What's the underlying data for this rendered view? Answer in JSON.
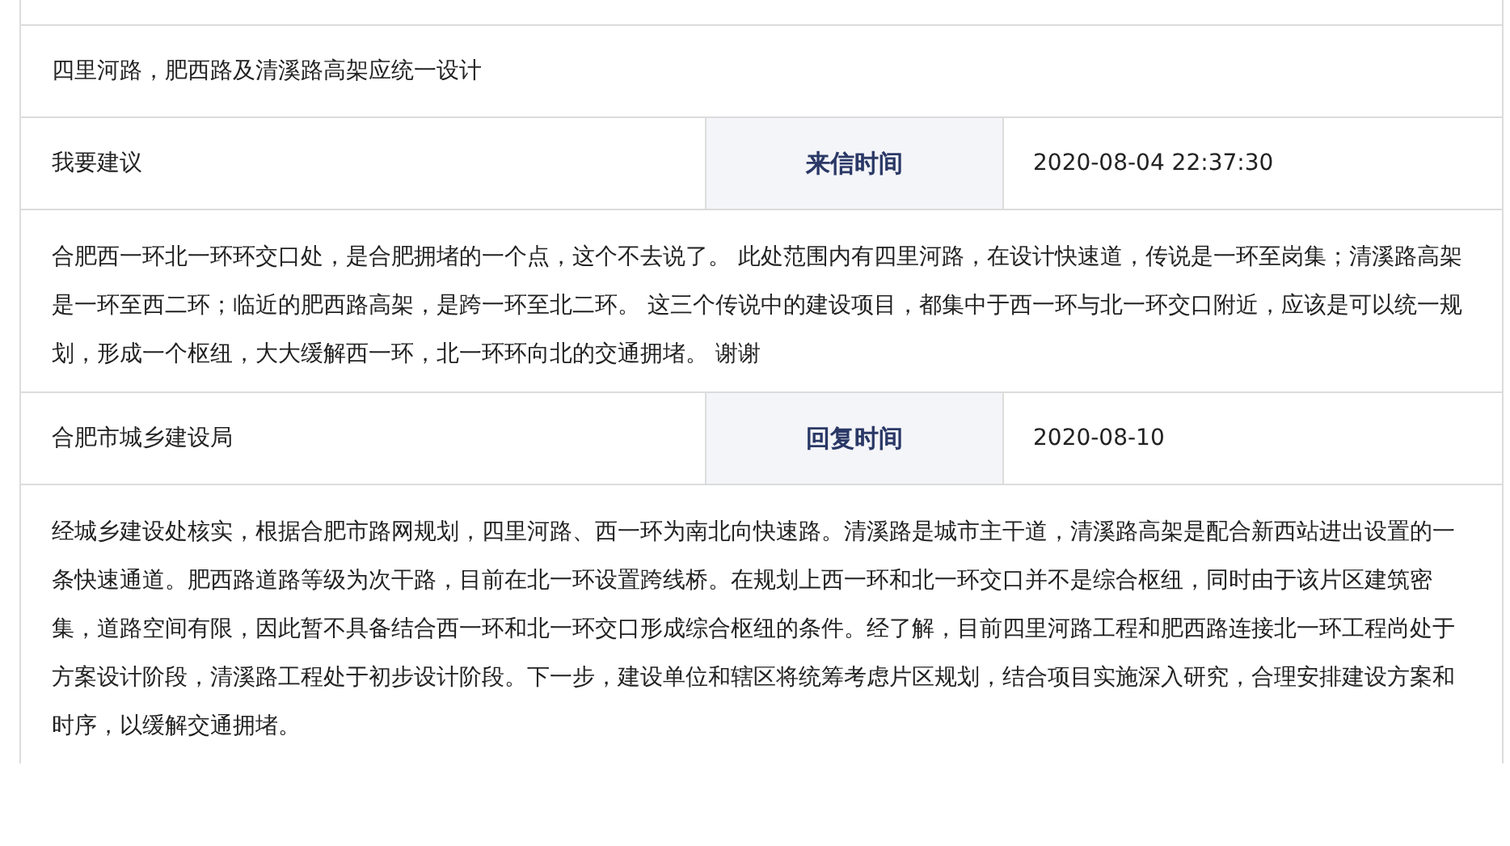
{
  "title": "四里河路，肥西路及清溪路高架应统一设计",
  "letter": {
    "sender": "我要建议",
    "time_label": "来信时间",
    "time": "2020-08-04 22:37:30",
    "content": "合肥西一环北一环环交口处，是合肥拥堵的一个点，这个不去说了。 此处范围内有四里河路，在设计快速道，传说是一环至岗集；清溪路高架是一环至西二环；临近的肥西路高架，是跨一环至北二环。 这三个传说中的建设项目，都集中于西一环与北一环交口附近，应该是可以统一规划，形成一个枢纽，大大缓解西一环，北一环环向北的交通拥堵。 谢谢"
  },
  "reply": {
    "sender": "合肥市城乡建设局",
    "time_label": "回复时间",
    "time": "2020-08-10",
    "content": "经城乡建设处核实，根据合肥市路网规划，四里河路、西一环为南北向快速路。清溪路是城市主干道，清溪路高架是配合新西站进出设置的一条快速通道。肥西路道路等级为次干路，目前在北一环设置跨线桥。在规划上西一环和北一环交口并不是综合枢纽，同时由于该片区建筑密集，道路空间有限，因此暂不具备结合西一环和北一环交口形成综合枢纽的条件。经了解，目前四里河路工程和肥西路连接北一环工程尚处于方案设计阶段，清溪路工程处于初步设计阶段。下一步，建设单位和辖区将统筹考虑片区规划，结合项目实施深入研究，合理安排建设方案和时序，以缓解交通拥堵。"
  }
}
